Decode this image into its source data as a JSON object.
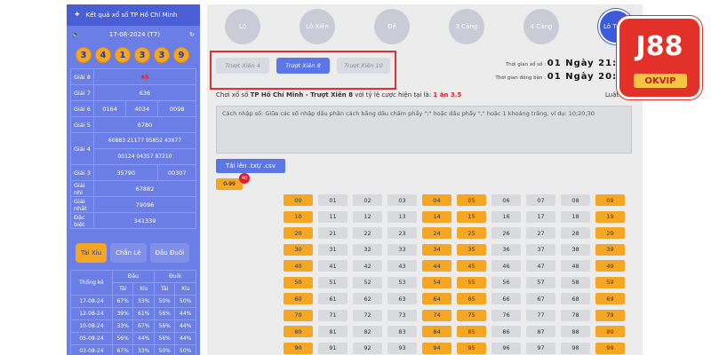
{
  "left": {
    "title": "Kết quả xổ số TP Hồ Chí Minh",
    "date": "17-08-2024 (T7)",
    "balls": [
      "3",
      "4",
      "1",
      "3",
      "3",
      "9"
    ],
    "results": [
      {
        "label": "Giải 8",
        "values": [
          "65"
        ]
      },
      {
        "label": "Giải 7",
        "values": [
          "636"
        ]
      },
      {
        "label": "Giải 6",
        "values": [
          "0164",
          "4034",
          "0098"
        ]
      },
      {
        "label": "Giải 5",
        "values": [
          "6780"
        ]
      },
      {
        "label": "Giải 4",
        "values": [
          "60883",
          "21177",
          "95852",
          "43877",
          "00124",
          "04357",
          "87210"
        ]
      },
      {
        "label": "Giải 3",
        "values": [
          "35790",
          "00307"
        ]
      },
      {
        "label": "Giải nhì",
        "values": [
          "67882"
        ]
      },
      {
        "label": "Giải nhất",
        "values": [
          "79096"
        ]
      },
      {
        "label": "Đặc biệt",
        "values": [
          "341339"
        ]
      }
    ],
    "tabs": [
      "Tài Xỉu",
      "Chẵn Lẻ",
      "Đầu Đuôi"
    ],
    "stats": {
      "header1": "Thống kê",
      "header_dau": "Đầu",
      "header_duoi": "Đuôi",
      "sub": [
        "Tài",
        "Xỉu",
        "Tài",
        "Xỉu"
      ],
      "rows": [
        {
          "date": "17-08-24",
          "vals": [
            "67%",
            "33%",
            "50%",
            "50%"
          ]
        },
        {
          "date": "12-08-24",
          "vals": [
            "39%",
            "61%",
            "56%",
            "44%"
          ]
        },
        {
          "date": "10-08-24",
          "vals": [
            "33%",
            "67%",
            "56%",
            "44%"
          ]
        },
        {
          "date": "05-08-24",
          "vals": [
            "56%",
            "44%",
            "56%",
            "44%"
          ]
        },
        {
          "date": "03-08-24",
          "vals": [
            "67%",
            "33%",
            "50%",
            "50%"
          ]
        }
      ]
    }
  },
  "main": {
    "game_tabs": [
      "Lô",
      "Lô Xiên",
      "Đề",
      "3 Càng",
      "4 Càng",
      "Lô Trượt"
    ],
    "sub_tabs": [
      "Trượt Xiên 4",
      "Trượt Xiên 8",
      "Trượt Xiên 10"
    ],
    "time_close_label": "Thời gian xổ số :",
    "time_close_val": "01 Ngày 21:07:",
    "time_open_label": "Thời gian đóng bàn :",
    "time_open_val": "01 Ngày 20:52:",
    "info_prefix": "Chơi xổ số ",
    "info_city": "TP Hồ Chí Minh - Trượt Xiên 8",
    "info_mid": " với tỷ lệ cược hiện tại là: ",
    "info_rate": "1 ăn 3.5",
    "rules_link": "Luật chơi",
    "instructions": "Cách nhập số: Giữa các số nhập dấu phân cách bằng dấu chấm phẩy \";\" hoặc dấu phẩy \",\" hoặc 1 khoảng trắng, ví dụ: 10;20;30",
    "upload_label": "Tải lên .txt/ .csv",
    "range_label": "0-99",
    "count": "40"
  },
  "logo": {
    "text": "J88",
    "sub": "OKVIP"
  },
  "colors": {
    "accent": "#5c76e6",
    "orange": "#f5a623",
    "red": "#e0202a"
  }
}
